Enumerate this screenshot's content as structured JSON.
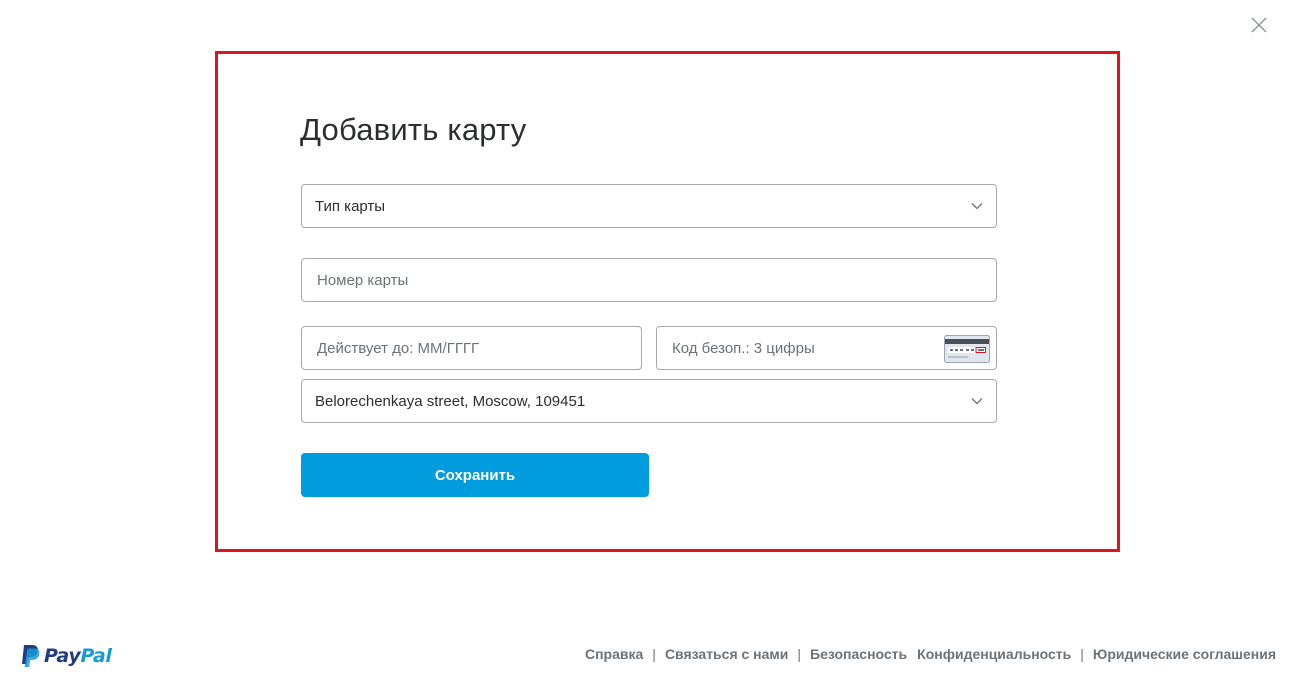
{
  "modal": {
    "title": "Добавить карту",
    "card_type": {
      "value": "Тип карты"
    },
    "card_number": {
      "placeholder": "Номер карты"
    },
    "expiry": {
      "placeholder": "Действует до: ММ/ГГГГ"
    },
    "cvv": {
      "placeholder": "Код безоп.: 3 цифры",
      "icon": "card-back-cvv-icon"
    },
    "billing_address": {
      "value": "Belorechenkaya street, Moscow, 109451"
    },
    "save_label": "Сохранить",
    "close_icon": "close-icon"
  },
  "footer": {
    "logo_pay": "Pay",
    "logo_pal": "Pal",
    "links": {
      "help": "Справка",
      "contact": "Связаться с нами",
      "security": "Безопасность",
      "privacy": "Конфиденциальность",
      "legal": "Юридические соглашения"
    },
    "separator": "|"
  },
  "colors": {
    "accent": "#009cde",
    "highlight_border": "#e0141e",
    "paypal_dark": "#253b80",
    "paypal_light": "#179bd7",
    "text": "#2c2e2f",
    "muted": "#6c7378"
  }
}
